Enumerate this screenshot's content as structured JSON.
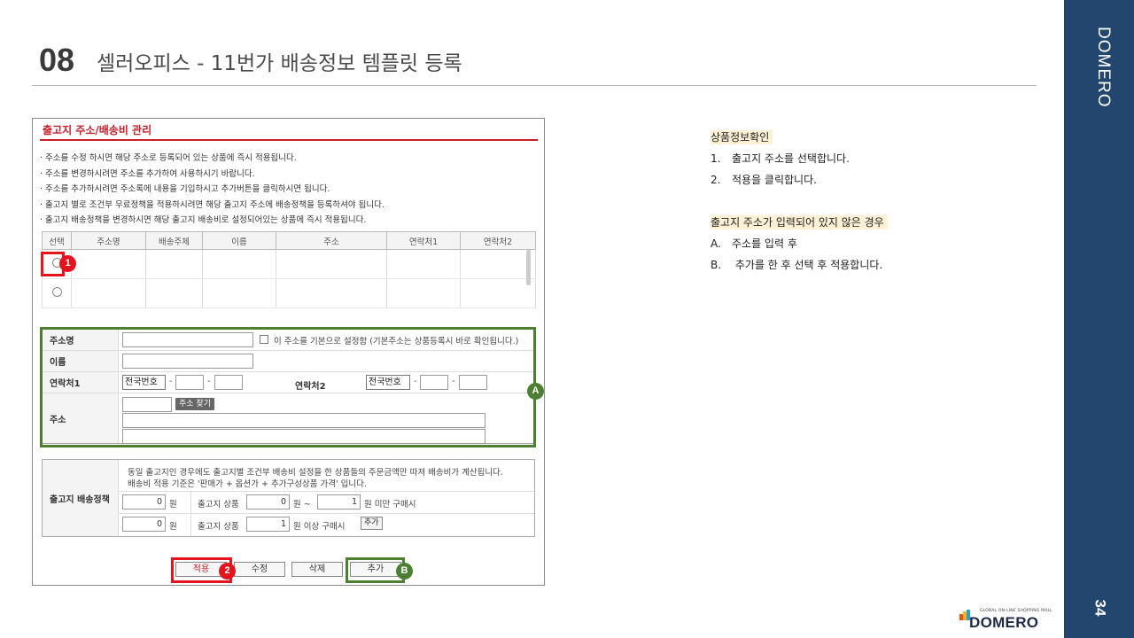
{
  "header": {
    "slide_number": "08",
    "title": "셀러오피스 - 11번가 배송정보 템플릿 등록"
  },
  "band": {
    "brand": "DOMERO",
    "page": "34"
  },
  "window": {
    "title": "출고지 주소/배송비 관리",
    "notes": [
      "· 주소를 수정 하시면 해당 주소로 등록되어 있는 상품에 즉시 적용됩니다.",
      "· 주소를 변경하시려면 주소를 추가하여 사용하시기 바랍니다.",
      "· 주소를 추가하시려면 주소록에 내용을 기입하시고 추가버튼을 클릭하시면 됩니다.",
      "· 출고지 별로 조건부 무료정책을 적용하시려면 해당 출고지 주소에 배송정책을 등록하셔야 됩니다.",
      "· 출고지 배송정책을 변경하시면 해당 출고지 배송비로 설정되어있는 상품에 즉시 적용됩니다."
    ],
    "table_headers": [
      "선택",
      "주소명",
      "배송주체",
      "이름",
      "주소",
      "연락처1",
      "연락처2"
    ]
  },
  "form": {
    "address_name_label": "주소명",
    "default_checkbox_label": "이 주소를 기본으로 설정함 (기본주소는 상품등록시 바로 확인됩니다.)",
    "name_label": "이름",
    "phone1_label": "연락처1",
    "phone2_label": "연락처2",
    "area_code_value": "전국번호",
    "address_label": "주소",
    "find_address_button": "주소 찾기",
    "dash": "-"
  },
  "policy": {
    "label": "출고지 배송정책",
    "desc1": "동일 출고지인 경우에도 출고지별 조건부 배송비 설정을 한 상품들의 주문금액만 따져 배송비가 계산됩니다.",
    "desc2": "배송비 적용 기준은 '판매가 + 옵션가 + 추가구성상품 가격' 입니다.",
    "row1_fee": "0",
    "row2_fee": "0",
    "won": "원",
    "product_label": "출고지 상품",
    "row1_from": "0",
    "won_tilde": "원 ~",
    "row1_to": "1",
    "under_text": "원 미만 구매시",
    "row2_from": "1",
    "over_text": "원 이상 구매시",
    "add_button": "추가"
  },
  "buttons": {
    "apply": "적용",
    "edit": "수정",
    "delete": "삭제",
    "add": "추가"
  },
  "badges": {
    "one": "1",
    "two": "2",
    "a": "A",
    "b": "B"
  },
  "info": {
    "section1_title": "상품정보확인",
    "section1_items": [
      {
        "marker": "1.",
        "text": "출고지 주소를 선택합니다."
      },
      {
        "marker": "2.",
        "text": "적용을 클릭합니다."
      }
    ],
    "section2_title": "출고지 주소가 입력되어 있지 않은 경우",
    "section2_items": [
      {
        "marker": "A.",
        "text": "주소를 입력 후"
      },
      {
        "marker": "B.",
        "text": " 추가를 한 후 선택 후 적용합니다."
      }
    ]
  },
  "logo": {
    "tagline": "GLOBAL ON-LINE SHOPPING MALL",
    "wordmark": "DOMERO"
  },
  "colors": {
    "band": "#23466f",
    "accent_red": "#e3141e",
    "accent_green": "#4d7f33",
    "window_title": "#c8202b"
  }
}
